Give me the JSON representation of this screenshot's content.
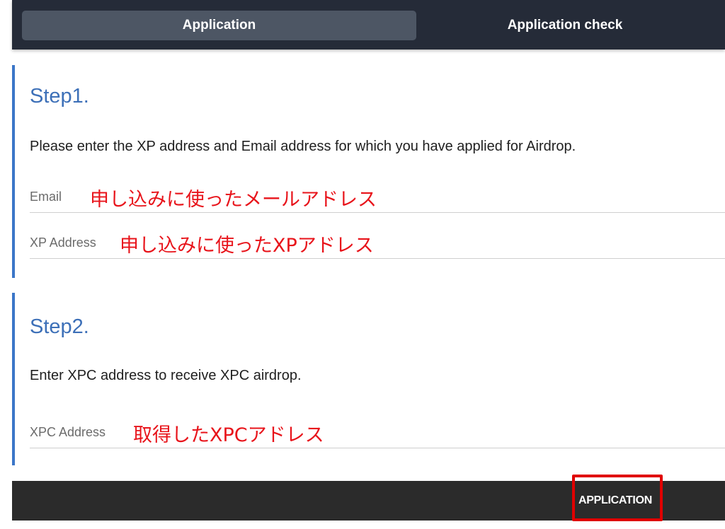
{
  "tabs": [
    {
      "label": "Application",
      "active": true
    },
    {
      "label": "Application check",
      "active": false
    }
  ],
  "step1": {
    "title": "Step1.",
    "description": "Please enter the XP address and Email address for which you have applied for Airdrop.",
    "fields": [
      {
        "label": "Email",
        "value": "申し込みに使ったメールアドレス"
      },
      {
        "label": "XP Address",
        "value": "申し込みに使ったXPアドレス"
      }
    ]
  },
  "step2": {
    "title": "Step2.",
    "description": "Enter XPC address to receive XPC airdrop.",
    "fields": [
      {
        "label": "XPC Address",
        "value": "取得したXPCアドレス"
      }
    ]
  },
  "footer": {
    "button_label": "APPLICATION"
  },
  "colors": {
    "tabbar_bg": "#252b38",
    "active_tab_bg": "#4d5664",
    "accent_blue": "#3b76c8",
    "annotation_red": "#e8141b",
    "footer_bg": "#2b2b2b",
    "highlight_red": "#e00000"
  }
}
